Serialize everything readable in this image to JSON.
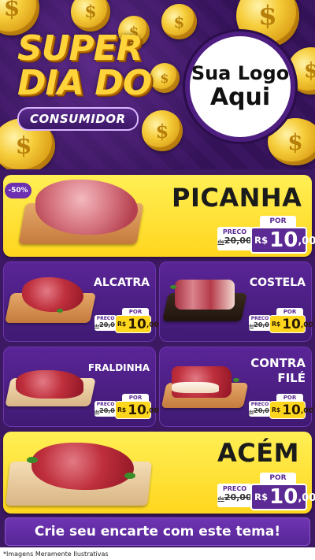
{
  "header": {
    "title_line1": "SUPER",
    "title_line2": "DIA DO",
    "subtitle": "CONSUMIDOR",
    "logo_line1": "Sua Logo",
    "logo_line2": "Aqui"
  },
  "products": {
    "picanha": {
      "name": "PICANHA",
      "discount": "-50%",
      "preco_label": "PRECO",
      "por_label": "POR",
      "old_prefix": "de",
      "old_price": "20,00",
      "currency": "R$",
      "price_int": "10",
      "price_dec": ",00",
      "unit": "KG"
    },
    "alcatra": {
      "name": "ALCATRA",
      "preco_label": "PRECO",
      "por_label": "POR",
      "old_prefix": "de",
      "old_price": "20,00",
      "currency": "R$",
      "price_int": "10",
      "price_dec": ",00",
      "unit": "KG"
    },
    "costela": {
      "name": "COSTELA",
      "preco_label": "PRECO",
      "por_label": "POR",
      "old_prefix": "de",
      "old_price": "20,00",
      "currency": "R$",
      "price_int": "10",
      "price_dec": ",00",
      "unit": "KG"
    },
    "fraldinha": {
      "name": "FRALDINHA",
      "preco_label": "PRECO",
      "por_label": "POR",
      "old_prefix": "de",
      "old_price": "20,00",
      "currency": "R$",
      "price_int": "10",
      "price_dec": ",00",
      "unit": "KG"
    },
    "contrafile": {
      "name_line1": "CONTRA",
      "name_line2": "FILÉ",
      "preco_label": "PRECO",
      "por_label": "POR",
      "old_prefix": "de",
      "old_price": "20,00",
      "currency": "R$",
      "price_int": "10",
      "price_dec": ",00",
      "unit": "KG"
    },
    "acem": {
      "name": "ACÉM",
      "preco_label": "PRECO",
      "por_label": "POR",
      "old_prefix": "de",
      "old_price": "20,00",
      "currency": "R$",
      "price_int": "10",
      "price_dec": ",00",
      "unit": "KG"
    }
  },
  "footer": {
    "banner": "Crie seu encarte com este tema!",
    "disclaimer": "*Imagens Meramente Ilustrativas"
  },
  "colors": {
    "primary_purple": "#5b2a94",
    "yellow": "#ffd61e",
    "dark_bg": "#3d1863"
  }
}
